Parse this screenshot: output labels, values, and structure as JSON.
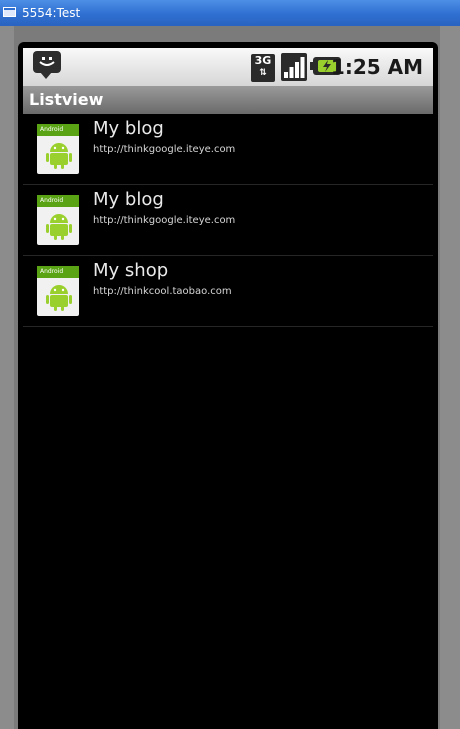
{
  "window": {
    "title": "5554:Test"
  },
  "status_bar": {
    "network_type": "3G",
    "time": "1:25 AM",
    "icons": [
      "message-icon",
      "3g-data-icon",
      "signal-strength-icon",
      "battery-charging-icon"
    ]
  },
  "app": {
    "title": "Listview"
  },
  "list": {
    "items": [
      {
        "title": "My blog",
        "url": "http://thinkgoogle.iteye.com",
        "thumb_label": "Android"
      },
      {
        "title": "My blog",
        "url": "http://thinkgoogle.iteye.com",
        "thumb_label": "Android"
      },
      {
        "title": "My shop",
        "url": "http://thinkcool.taobao.com",
        "thumb_label": "Android"
      }
    ]
  },
  "colors": {
    "titlebar_blue": "#2f6fd1",
    "android_green": "#9ad02d",
    "list_background": "#000000"
  }
}
